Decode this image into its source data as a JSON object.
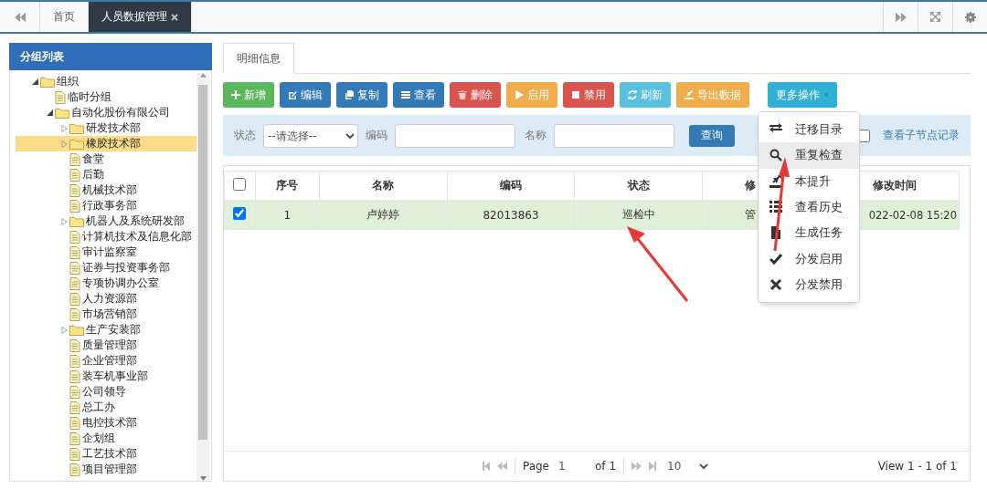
{
  "top_tabs": [
    {
      "label": "首页",
      "selected": false,
      "closable": false
    },
    {
      "label": "人员数据管理",
      "selected": true,
      "closable": true
    }
  ],
  "sidebar": {
    "title": "分组列表",
    "tree": [
      {
        "label": "组织",
        "kind": "folder",
        "expanded": true,
        "selected": false,
        "children": [
          {
            "label": "临时分组",
            "kind": "file",
            "selected": false
          },
          {
            "label": "自动化股份有限公司",
            "kind": "folder",
            "expanded": true,
            "selected": false,
            "children": [
              {
                "label": "研发技术部",
                "kind": "folder",
                "expanded": false,
                "selected": false
              },
              {
                "label": "橡胶技术部",
                "kind": "folder",
                "expanded": false,
                "selected": true
              },
              {
                "label": "食堂",
                "kind": "file",
                "selected": false
              },
              {
                "label": "后勤",
                "kind": "file",
                "selected": false
              },
              {
                "label": "机械技术部",
                "kind": "file",
                "selected": false
              },
              {
                "label": "行政事务部",
                "kind": "file",
                "selected": false
              },
              {
                "label": "机器人及系统研发部",
                "kind": "folder",
                "expanded": false,
                "selected": false
              },
              {
                "label": "计算机技术及信息化部",
                "kind": "file",
                "selected": false
              },
              {
                "label": "审计监察室",
                "kind": "file",
                "selected": false
              },
              {
                "label": "证券与投资事务部",
                "kind": "file",
                "selected": false
              },
              {
                "label": "专项协调办公室",
                "kind": "file",
                "selected": false
              },
              {
                "label": "人力资源部",
                "kind": "file",
                "selected": false
              },
              {
                "label": "市场营销部",
                "kind": "file",
                "selected": false
              },
              {
                "label": "生产安装部",
                "kind": "folder",
                "expanded": false,
                "selected": false
              },
              {
                "label": "质量管理部",
                "kind": "file",
                "selected": false
              },
              {
                "label": "企业管理部",
                "kind": "file",
                "selected": false
              },
              {
                "label": "装车机事业部",
                "kind": "file",
                "selected": false
              },
              {
                "label": "公司领导",
                "kind": "file",
                "selected": false
              },
              {
                "label": "总工办",
                "kind": "file",
                "selected": false
              },
              {
                "label": "电控技术部",
                "kind": "file",
                "selected": false
              },
              {
                "label": "企划组",
                "kind": "file",
                "selected": false
              },
              {
                "label": "工艺技术部",
                "kind": "file",
                "selected": false
              },
              {
                "label": "项目管理部",
                "kind": "file",
                "selected": false
              }
            ]
          }
        ]
      }
    ]
  },
  "content_tabs": [
    {
      "label": "明细信息",
      "selected": true
    }
  ],
  "toolbar": [
    {
      "label": "新增",
      "color": "#5cb85c"
    },
    {
      "label": "编辑",
      "color": "#337ab7"
    },
    {
      "label": "复制",
      "color": "#337ab7"
    },
    {
      "label": "查看",
      "color": "#337ab7"
    },
    {
      "label": "删除",
      "color": "#d9534f"
    },
    {
      "label": "启用",
      "color": "#f0ad4e"
    },
    {
      "label": "禁用",
      "color": "#d9534f"
    },
    {
      "label": "刷新",
      "color": "#5bc0de"
    },
    {
      "label": "导出数据",
      "color": "#f0ad4e"
    },
    {
      "label": "更多操作",
      "color": "#31b0d5"
    }
  ],
  "filter": {
    "status_label": "状态",
    "status_value": "--请选择--",
    "code_label": "编码",
    "name_label": "名称",
    "query_button": "查询",
    "child_checkbox": {
      "checked": false
    },
    "child_link": "查看子节点记录"
  },
  "table": {
    "header_checked": false,
    "columns": [
      "序号",
      "名称",
      "编码",
      "状态",
      "修",
      "修改时间"
    ],
    "rows": [
      {
        "selected": true,
        "cells": [
          "1",
          "卢婷婷",
          "82013863",
          "巡检中",
          "管",
          "022-02-08 15:20"
        ]
      }
    ]
  },
  "pager": {
    "page_label": "Page",
    "page_value": "1",
    "of_label": "of 1",
    "size": "10",
    "summary": "View 1 - 1 of 1"
  },
  "more_menu": [
    {
      "label": "迁移目录",
      "highlighted": false
    },
    {
      "label": "重复检查",
      "highlighted": true
    },
    {
      "label": "本提升",
      "highlighted": false
    },
    {
      "label": "查看历史",
      "highlighted": false
    },
    {
      "label": "生成任务",
      "highlighted": false
    },
    {
      "label": "分发启用",
      "highlighted": false
    },
    {
      "label": "分发禁用",
      "highlighted": false
    }
  ]
}
